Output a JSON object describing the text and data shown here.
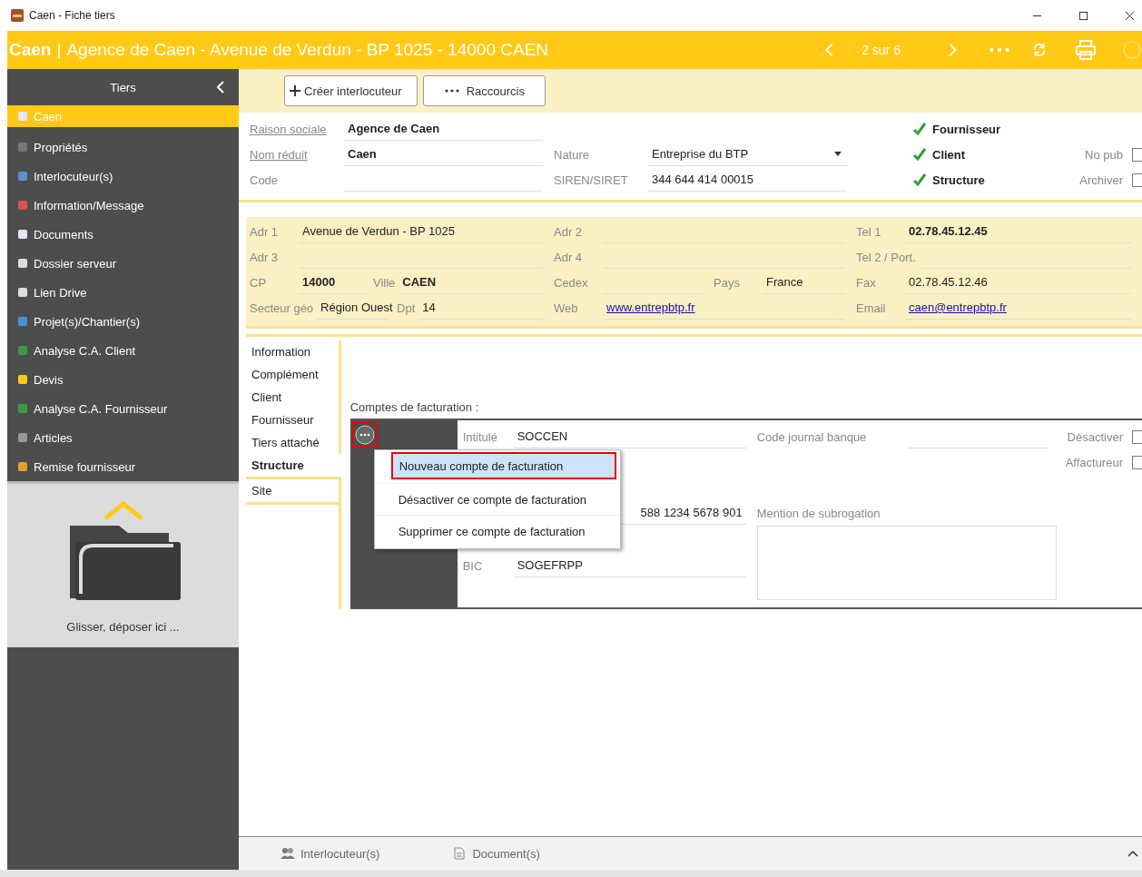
{
  "window": {
    "title": "Caen - Fiche tiers"
  },
  "header": {
    "name": "Caen",
    "separator": "|",
    "subtitle": "Agence de Caen - Avenue de Verdun - BP 1025 - 14000 CAEN",
    "pager": "2 sur 6"
  },
  "sidebar": {
    "title": "Tiers",
    "items": [
      {
        "label": "Caen",
        "selected": true
      },
      {
        "label": "Propriétés",
        "selected": false
      },
      {
        "label": "Interlocuteur(s)",
        "selected": false
      },
      {
        "label": "Information/Message",
        "selected": false
      },
      {
        "label": "Documents",
        "selected": false
      },
      {
        "label": "Dossier serveur",
        "selected": false
      },
      {
        "label": "Lien Drive",
        "selected": false
      },
      {
        "label": "Projet(s)/Chantier(s)",
        "selected": false
      },
      {
        "label": "Analyse C.A. Client",
        "selected": false
      },
      {
        "label": "Devis",
        "selected": false
      },
      {
        "label": "Analyse C.A. Fournisseur",
        "selected": false
      },
      {
        "label": "Articles",
        "selected": false
      },
      {
        "label": "Remise fournisseur",
        "selected": false
      }
    ],
    "dropzone": "Glisser, déposer ici ..."
  },
  "toolbar": {
    "buttons": [
      "Créer interlocuteur",
      "Raccourcis"
    ]
  },
  "identity": {
    "columns": [
      [
        {
          "label": "Raison sociale",
          "value": "Agence de Caen",
          "kind": "link-bold"
        },
        {
          "label": "Nom réduit",
          "value": "Caen",
          "kind": "link-bold"
        },
        {
          "label": "Code",
          "kind": "text"
        }
      ],
      [
        {
          "kind": "blank"
        },
        {
          "label": "Nature",
          "value": "Entreprise du BTP",
          "kind": "select"
        },
        {
          "label": "SIREN/SIRET",
          "value": "344 644 414 00015",
          "kind": "text"
        }
      ]
    ],
    "flags": [
      {
        "label": "Fournisseur",
        "checked": true
      },
      {
        "label": "Client",
        "checked": true
      },
      {
        "label": "Structure",
        "checked": true
      }
    ],
    "options": [
      {
        "label": "No pub",
        "checked": false
      },
      {
        "label": "Archiver",
        "checked": false
      }
    ]
  },
  "address": {
    "rows": [
      [
        [
          {
            "label": "Adr 1",
            "value": "Avenue de Verdun - BP 1025",
            "kind": "text"
          }
        ],
        [
          {
            "label": "Adr 2",
            "kind": "text"
          }
        ],
        [
          {
            "label": "Tel 1",
            "value": "02.78.45.12.45",
            "kind": "bold"
          }
        ]
      ],
      [
        [
          {
            "label": "Adr 3",
            "kind": "text"
          }
        ],
        [
          {
            "label": "Adr 4",
            "kind": "text"
          }
        ],
        [
          {
            "label": "Tel 2 / Port.",
            "kind": "text"
          }
        ]
      ],
      [
        [
          {
            "label": "CP",
            "value": "14000",
            "kind": "bold"
          },
          {
            "label": "Ville",
            "value": "CAEN",
            "kind": "bold"
          }
        ],
        [
          {
            "label": "Cedex",
            "kind": "text"
          },
          {
            "label": "Pays",
            "value": "France",
            "kind": "text"
          }
        ],
        [
          {
            "label": "Fax",
            "value": "02.78.45.12.46",
            "kind": "text"
          }
        ]
      ],
      [
        [
          {
            "label": "Secteur géo",
            "value": "Région Ouest",
            "kind": "select"
          },
          {
            "label": "Dpt",
            "value": "14",
            "kind": "text"
          }
        ],
        [
          {
            "label": "Web",
            "value": "www.entrepbtp.fr",
            "kind": "link"
          }
        ],
        [
          {
            "label": "Email",
            "value": "caen@entrepbtp.fr",
            "kind": "link"
          }
        ]
      ]
    ]
  },
  "tabs": [
    {
      "label": "Information",
      "selected": false
    },
    {
      "label": "Complément",
      "selected": false
    },
    {
      "label": "Client",
      "selected": false
    },
    {
      "label": "Fournisseur",
      "selected": false
    },
    {
      "label": "Tiers attaché",
      "selected": false
    },
    {
      "label": "Structure",
      "selected": true
    },
    {
      "label": "Site",
      "selected": false
    }
  ],
  "billing": {
    "title": "Comptes de facturation :",
    "fields": [
      {
        "label": "Intitulé",
        "value": "SOCCEN"
      },
      {
        "value": "588 1234 5678 901"
      },
      {
        "label": "BIC",
        "value": "SOGEFRPP"
      }
    ],
    "extra": [
      {
        "label": "Code journal banque"
      },
      {
        "label": "Mention de subrogation"
      }
    ],
    "options": [
      {
        "label": "Désactiver",
        "checked": false
      },
      {
        "label": "Affactureur",
        "checked": false
      }
    ],
    "menu": [
      {
        "label": "Nouveau compte de facturation",
        "selected": true
      },
      {
        "label": "Désactiver ce compte de facturation",
        "selected": false
      },
      {
        "label": "Supprimer ce compte de facturation",
        "selected": false
      }
    ]
  },
  "bottom_tabs": [
    "Interlocuteur(s)",
    "Document(s)"
  ]
}
